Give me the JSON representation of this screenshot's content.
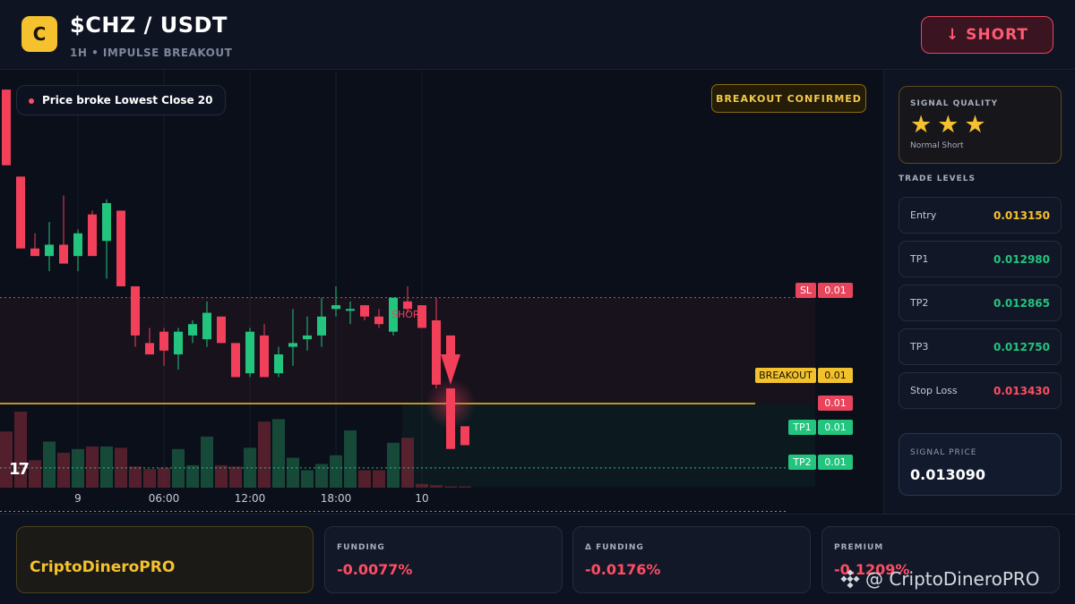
{
  "header": {
    "logo_letter": "C",
    "pair": "$CHZ / USDT",
    "subtitle": "1H • IMPULSE BREAKOUT",
    "short_label": "↓ SHORT"
  },
  "chart": {
    "alert": "Price broke Lowest Close 20",
    "badge": "BREAKOUT CONFIRMED",
    "short_marker": "SHORT",
    "tv_logo": "17",
    "tags": {
      "sl_label": "SL",
      "sl_value": "0.01",
      "breakout_label": "BREAKOUT",
      "breakout_value": "0.01",
      "price_value": "0.01",
      "tp1_label": "TP1",
      "tp1_value": "0.01",
      "tp2_label": "TP2",
      "tp2_value": "0.01"
    },
    "x_ticks": [
      "9",
      "06:00",
      "12:00",
      "18:00",
      "10"
    ]
  },
  "chart_data": {
    "type": "candlestick",
    "up_color": "#22c47e",
    "down_color": "#f23f5a",
    "candles": [
      {
        "o": 0.01398,
        "h": 0.01398,
        "l": 0.01378,
        "c": 0.01378
      },
      {
        "o": 0.01375,
        "h": 0.01375,
        "l": 0.01356,
        "c": 0.01356
      },
      {
        "o": 0.01356,
        "h": 0.0136,
        "l": 0.01354,
        "c": 0.01354
      },
      {
        "o": 0.01354,
        "h": 0.01363,
        "l": 0.0135,
        "c": 0.01357
      },
      {
        "o": 0.01357,
        "h": 0.0137,
        "l": 0.01352,
        "c": 0.01352
      },
      {
        "o": 0.01354,
        "h": 0.01361,
        "l": 0.0135,
        "c": 0.0136
      },
      {
        "o": 0.01365,
        "h": 0.01366,
        "l": 0.01354,
        "c": 0.01354
      },
      {
        "o": 0.01358,
        "h": 0.01369,
        "l": 0.01348,
        "c": 0.01368
      },
      {
        "o": 0.01366,
        "h": 0.01366,
        "l": 0.01346,
        "c": 0.01346
      },
      {
        "o": 0.01346,
        "h": 0.01346,
        "l": 0.0133,
        "c": 0.01333
      },
      {
        "o": 0.01331,
        "h": 0.01335,
        "l": 0.01328,
        "c": 0.01328
      },
      {
        "o": 0.01334,
        "h": 0.01335,
        "l": 0.01325,
        "c": 0.01329
      },
      {
        "o": 0.01328,
        "h": 0.01335,
        "l": 0.01324,
        "c": 0.01334
      },
      {
        "o": 0.01333,
        "h": 0.01337,
        "l": 0.01331,
        "c": 0.01336
      },
      {
        "o": 0.01332,
        "h": 0.01342,
        "l": 0.0133,
        "c": 0.01339
      },
      {
        "o": 0.01338,
        "h": 0.01338,
        "l": 0.01331,
        "c": 0.01331
      },
      {
        "o": 0.01331,
        "h": 0.01331,
        "l": 0.01322,
        "c": 0.01322
      },
      {
        "o": 0.01323,
        "h": 0.01335,
        "l": 0.01322,
        "c": 0.01334
      },
      {
        "o": 0.01333,
        "h": 0.01336,
        "l": 0.01322,
        "c": 0.01322
      },
      {
        "o": 0.01323,
        "h": 0.0133,
        "l": 0.01322,
        "c": 0.01328
      },
      {
        "o": 0.0133,
        "h": 0.0134,
        "l": 0.01325,
        "c": 0.01331
      },
      {
        "o": 0.01332,
        "h": 0.01338,
        "l": 0.01329,
        "c": 0.01333
      },
      {
        "o": 0.01333,
        "h": 0.01343,
        "l": 0.0133,
        "c": 0.01338
      },
      {
        "o": 0.0134,
        "h": 0.01346,
        "l": 0.01338,
        "c": 0.01341
      },
      {
        "o": 0.0134,
        "h": 0.01342,
        "l": 0.01336,
        "c": 0.0134
      },
      {
        "o": 0.01341,
        "h": 0.01341,
        "l": 0.01337,
        "c": 0.01338
      },
      {
        "o": 0.01338,
        "h": 0.0134,
        "l": 0.01335,
        "c": 0.01336
      },
      {
        "o": 0.01334,
        "h": 0.01343,
        "l": 0.01333,
        "c": 0.01343
      },
      {
        "o": 0.01342,
        "h": 0.01346,
        "l": 0.01339,
        "c": 0.0134
      },
      {
        "o": 0.01341,
        "h": 0.01341,
        "l": 0.01335,
        "c": 0.01335
      },
      {
        "o": 0.01337,
        "h": 0.01343,
        "l": 0.01319,
        "c": 0.0132
      },
      {
        "o": 0.01319,
        "h": 0.01319,
        "l": 0.01303,
        "c": 0.01303
      },
      {
        "o": 0.01309,
        "h": 0.01309,
        "l": 0.01304,
        "c": 0.01304
      }
    ],
    "volumes": [
      45,
      61,
      22,
      37,
      28,
      31,
      33,
      33,
      32,
      17,
      15,
      16,
      31,
      18,
      41,
      18,
      17,
      32,
      53,
      55,
      24,
      14,
      19,
      26,
      46,
      14,
      14,
      36,
      40,
      3,
      2,
      1,
      1
    ],
    "levels": {
      "sl": 0.01343,
      "breakout": 0.01315,
      "tp1": 0.01298,
      "tp2": 0.012865
    },
    "price_range": [
      0.01293,
      0.01403
    ]
  },
  "sidebar": {
    "quality_title": "SIGNAL QUALITY",
    "stars": "★★★",
    "quality_sub": "Normal Short",
    "levels_title": "TRADE LEVELS",
    "levels": [
      {
        "label": "Entry",
        "value": "0.013150",
        "color": "#f5c12e"
      },
      {
        "label": "TP1",
        "value": "0.012980",
        "color": "#22c47e"
      },
      {
        "label": "TP2",
        "value": "0.012865",
        "color": "#22c47e"
      },
      {
        "label": "TP3",
        "value": "0.012750",
        "color": "#22c47e"
      },
      {
        "label": "Stop Loss",
        "value": "0.013430",
        "color": "#ff4d64"
      }
    ],
    "signal_title": "SIGNAL PRICE",
    "signal_value": "0.013090"
  },
  "footer": {
    "brand": "CriptoDineroPRO",
    "stats": [
      {
        "title": "FUNDING",
        "value": "-0.0077%"
      },
      {
        "title": "Δ FUNDING",
        "value": "-0.0176%"
      },
      {
        "title": "PREMIUM",
        "value": "-0.1209%"
      }
    ],
    "watermark": "@ CriptoDineroPRO"
  }
}
